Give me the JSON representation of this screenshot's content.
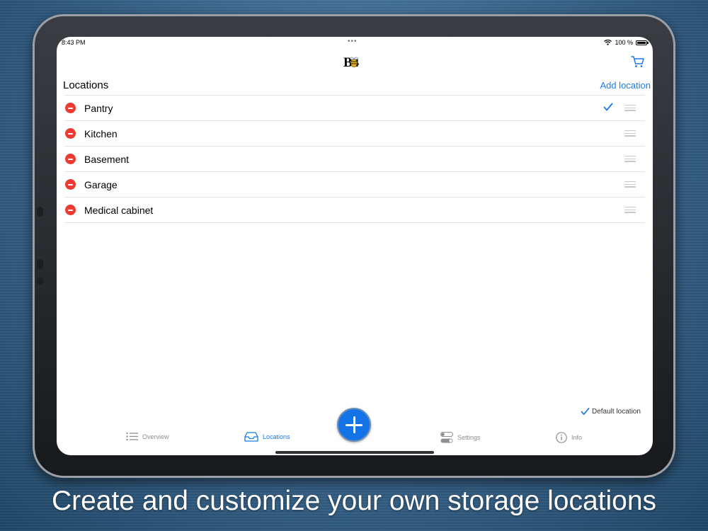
{
  "status_bar": {
    "time": "8:43 PM",
    "battery": "100 %"
  },
  "header": {
    "logo_text": "B4"
  },
  "locations_section": {
    "title": "Locations",
    "add_label": "Add location",
    "items": [
      {
        "label": "Pantry",
        "is_default": true
      },
      {
        "label": "Kitchen",
        "is_default": false
      },
      {
        "label": "Basement",
        "is_default": false
      },
      {
        "label": "Garage",
        "is_default": false
      },
      {
        "label": "Medical cabinet",
        "is_default": false
      }
    ]
  },
  "legend": {
    "label": "Default location"
  },
  "tab_bar": {
    "tabs": [
      {
        "label": "Overview",
        "icon": "list-icon",
        "active": false
      },
      {
        "label": "Locations",
        "icon": "tray-icon",
        "active": true
      },
      {
        "label": "Settings",
        "icon": "toggles-icon",
        "active": false
      },
      {
        "label": "Info",
        "icon": "info-icon",
        "active": false
      }
    ],
    "add_button_icon": "plus-icon"
  },
  "caption": "Create and customize your own storage locations",
  "colors": {
    "accent": "#1a7aee",
    "delete": "#ee3b32",
    "fab": "#1473e6"
  }
}
